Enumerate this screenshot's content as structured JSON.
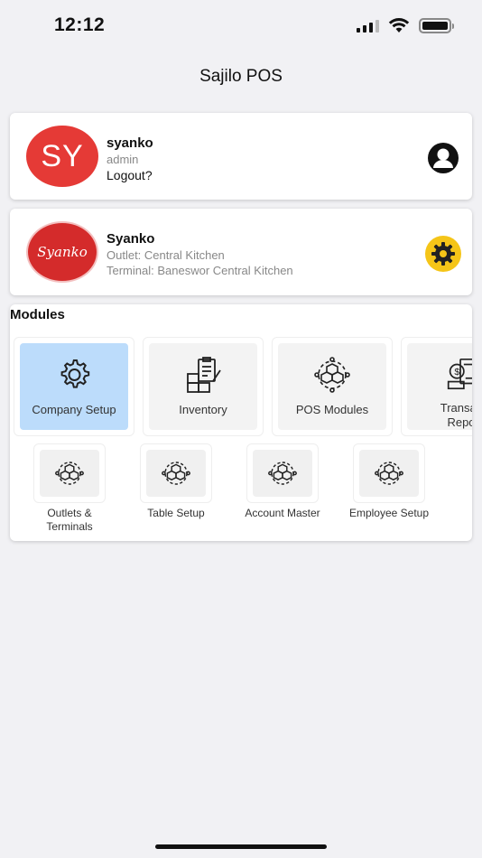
{
  "status_bar": {
    "time": "12:12"
  },
  "app": {
    "title": "Sajilo POS"
  },
  "user": {
    "initials": "SY",
    "name": "syanko",
    "role": "admin",
    "logout_label": "Logout?",
    "icon": "user-profile-icon"
  },
  "outlet": {
    "logo_text": "Syanko",
    "name": "Syanko",
    "outlet_line": "Outlet: Central Kitchen",
    "terminal_line": "Terminal: Baneswor Central Kitchen",
    "icon": "gear-icon"
  },
  "modules": {
    "title": "Modules",
    "row1": [
      {
        "label": "Company Setup",
        "icon": "gear-icon",
        "active": true
      },
      {
        "label": "Inventory",
        "icon": "inventory-icon",
        "active": false
      },
      {
        "label": "POS Modules",
        "icon": "cubes-network-icon",
        "active": false
      },
      {
        "label": "Transac\nRepo",
        "icon": "transaction-report-icon",
        "active": false
      }
    ],
    "row2": [
      {
        "label": "Outlets &\nTerminals",
        "icon": "cubes-network-icon"
      },
      {
        "label": "Table Setup",
        "icon": "cubes-network-icon"
      },
      {
        "label": "Account Master",
        "icon": "cubes-network-icon"
      },
      {
        "label": "Employee Setup",
        "icon": "cubes-network-icon"
      }
    ]
  },
  "colors": {
    "accent_red": "#e53a36",
    "active_tile": "#bcdcfb",
    "settings_yellow": "#f5c518"
  }
}
